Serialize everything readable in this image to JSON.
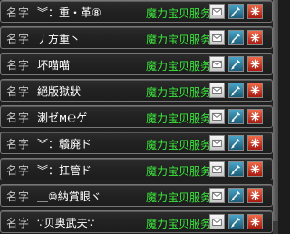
{
  "rows": [
    {
      "label": "名字",
      "name": "︾：重・革⑧",
      "server": "魔力宝贝服务器"
    },
    {
      "label": "名字",
      "name": "丿方重丶",
      "server": "魔力宝贝服务器"
    },
    {
      "label": "名字",
      "name": "坏喵喵",
      "server": "魔力宝贝服务器"
    },
    {
      "label": "名字",
      "name": "絕版獄狀",
      "server": "魔力宝贝服务器"
    },
    {
      "label": "名字",
      "name": "溂ゼм℮ゲ",
      "server": "魔力宝贝服务器"
    },
    {
      "label": "名字",
      "name": "︾：贛廃ド",
      "server": "魔力宝贝服务器"
    },
    {
      "label": "名字",
      "name": "︾：扛管ド",
      "server": "魔力宝贝服务器"
    },
    {
      "label": "名字",
      "name": "＿⑩納賞眼ヾ",
      "server": "魔力宝贝服务器"
    },
    {
      "label": "名字",
      "name": "∵贝奥武夫∵",
      "server": "魔力宝贝服务器"
    }
  ],
  "icons": {
    "mail": "mail-icon",
    "tool": "tool-icon",
    "close": "close-icon"
  },
  "colors": {
    "server_text": "#3ce83c",
    "name_text": "#ffffff",
    "row_border": "#777777"
  }
}
